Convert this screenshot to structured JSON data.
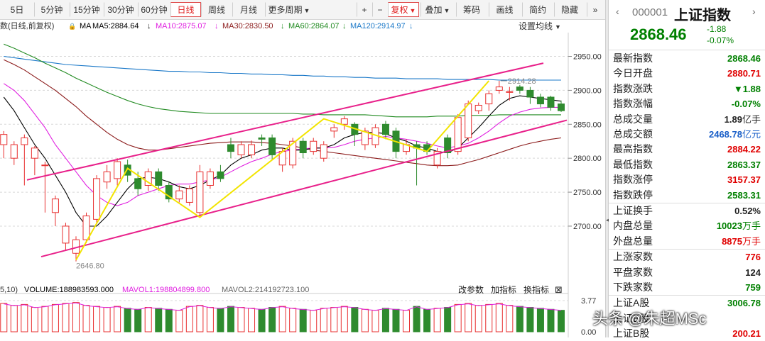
{
  "toolbar": {
    "periods": [
      "5日",
      "5分钟",
      "15分钟",
      "30分钟",
      "60分钟",
      "日线",
      "周线",
      "月线",
      "更多周期"
    ],
    "selected_period": "日线",
    "right_buttons": [
      "+",
      "−",
      "复权",
      "叠加",
      "筹码",
      "画线",
      "简约",
      "隐藏",
      "»"
    ],
    "selected_right": "复权"
  },
  "info": {
    "prefix": "数(日线,前复权)",
    "ma_label": "MA",
    "ma5": "MA5:2884.64",
    "ma10": "MA10:2875.07",
    "ma30": "MA30:2830.50",
    "ma60": "MA60:2864.07",
    "ma120": "MA120:2914.97",
    "set_ma": "设置均线",
    "arrow": "↓"
  },
  "colors": {
    "up": "#e83030",
    "down": "#2e8b2e",
    "ma5": "#000000",
    "ma10": "#e020e0",
    "ma30": "#8b1a1a",
    "ma60": "#228b22",
    "ma120": "#1a78c8",
    "channel": "#e8208a",
    "wave": "#f2e400"
  },
  "chart_data": {
    "type": "candlestick",
    "price_ticks": [
      "2950.00",
      "2900.00",
      "2850.00",
      "2800.00",
      "2750.00",
      "2700.00"
    ],
    "price_tick_values": [
      2950,
      2900,
      2850,
      2800,
      2750,
      2700
    ],
    "ylim": [
      2630,
      2985
    ],
    "high_label": "2914.28",
    "low_label": "2646.80",
    "candles": [
      [
        2820,
        2835,
        2800,
        2840
      ],
      [
        2800,
        2820,
        2790,
        2825
      ],
      [
        2820,
        2830,
        2760,
        2835
      ],
      [
        2800,
        2815,
        2775,
        2818
      ],
      [
        2790,
        2790,
        2720,
        2795
      ],
      [
        2720,
        2740,
        2700,
        2745
      ],
      [
        2675,
        2700,
        2665,
        2705
      ],
      [
        2660,
        2680,
        2648,
        2685
      ],
      [
        2680,
        2715,
        2675,
        2720
      ],
      [
        2710,
        2770,
        2705,
        2775
      ],
      [
        2765,
        2780,
        2755,
        2790
      ],
      [
        2770,
        2795,
        2760,
        2800
      ],
      [
        2790,
        2775,
        2765,
        2798
      ],
      [
        2770,
        2755,
        2745,
        2780
      ],
      [
        2760,
        2780,
        2752,
        2785
      ],
      [
        2780,
        2760,
        2752,
        2785
      ],
      [
        2760,
        2740,
        2735,
        2765
      ],
      [
        2740,
        2752,
        2735,
        2760
      ],
      [
        2735,
        2755,
        2730,
        2760
      ],
      [
        2720,
        2780,
        2715,
        2790
      ],
      [
        2760,
        2780,
        2755,
        2785
      ],
      [
        2780,
        2770,
        2765,
        2790
      ],
      [
        2820,
        2810,
        2800,
        2830
      ],
      [
        2805,
        2820,
        2800,
        2825
      ],
      [
        2805,
        2820,
        2800,
        2826
      ],
      [
        2830,
        2828,
        2818,
        2835
      ],
      [
        2830,
        2805,
        2798,
        2835
      ],
      [
        2790,
        2810,
        2780,
        2815
      ],
      [
        2790,
        2825,
        2785,
        2830
      ],
      [
        2825,
        2808,
        2800,
        2830
      ],
      [
        2810,
        2825,
        2805,
        2830
      ],
      [
        2800,
        2820,
        2795,
        2825
      ],
      [
        2840,
        2845,
        2830,
        2850
      ],
      [
        2850,
        2858,
        2842,
        2862
      ],
      [
        2850,
        2835,
        2818,
        2853
      ],
      [
        2820,
        2840,
        2812,
        2845
      ],
      [
        2820,
        2845,
        2815,
        2850
      ],
      [
        2850,
        2835,
        2828,
        2855
      ],
      [
        2840,
        2810,
        2800,
        2845
      ],
      [
        2810,
        2820,
        2805,
        2828
      ],
      [
        2820,
        2815,
        2760,
        2825
      ],
      [
        2820,
        2810,
        2805,
        2825
      ],
      [
        2790,
        2810,
        2785,
        2815
      ],
      [
        2830,
        2808,
        2800,
        2835
      ],
      [
        2810,
        2860,
        2805,
        2865
      ],
      [
        2830,
        2880,
        2825,
        2885
      ],
      [
        2870,
        2878,
        2865,
        2882
      ],
      [
        2880,
        2895,
        2870,
        2900
      ],
      [
        2900,
        2905,
        2895,
        2914
      ],
      [
        2897,
        2898,
        2885,
        2905
      ],
      [
        2905,
        2900,
        2895,
        2908
      ],
      [
        2900,
        2890,
        2880,
        2905
      ],
      [
        2890,
        2880,
        2875,
        2895
      ],
      [
        2890,
        2875,
        2870,
        2892
      ],
      [
        2880,
        2870,
        2868,
        2885
      ]
    ],
    "ma_series": {
      "ma5": [
        2890,
        2870,
        2845,
        2820,
        2800,
        2775,
        2750,
        2720,
        2700,
        2700,
        2715,
        2735,
        2755,
        2770,
        2772,
        2770,
        2765,
        2758,
        2755,
        2760,
        2768,
        2775,
        2790,
        2800,
        2805,
        2812,
        2815,
        2815,
        2812,
        2812,
        2815,
        2815,
        2820,
        2830,
        2835,
        2838,
        2838,
        2836,
        2830,
        2825,
        2818,
        2815,
        2810,
        2808,
        2815,
        2830,
        2845,
        2862,
        2878,
        2888,
        2892,
        2890,
        2888,
        2886,
        2884
      ],
      "ma10": [
        2910,
        2900,
        2885,
        2865,
        2845,
        2820,
        2800,
        2780,
        2760,
        2745,
        2735,
        2730,
        2735,
        2745,
        2750,
        2755,
        2760,
        2762,
        2762,
        2765,
        2768,
        2772,
        2780,
        2788,
        2795,
        2800,
        2806,
        2810,
        2812,
        2814,
        2815,
        2815,
        2816,
        2820,
        2825,
        2828,
        2830,
        2832,
        2830,
        2828,
        2825,
        2822,
        2818,
        2815,
        2818,
        2822,
        2830,
        2840,
        2852,
        2862,
        2868,
        2872,
        2874,
        2875,
        2875
      ],
      "ma30": [
        2945,
        2938,
        2930,
        2920,
        2910,
        2900,
        2888,
        2876,
        2862,
        2850,
        2838,
        2828,
        2820,
        2815,
        2812,
        2812,
        2814,
        2816,
        2818,
        2820,
        2822,
        2823,
        2824,
        2824,
        2824,
        2823,
        2822,
        2820,
        2818,
        2815,
        2812,
        2810,
        2808,
        2806,
        2804,
        2802,
        2800,
        2798,
        2796,
        2794,
        2792,
        2790,
        2789,
        2789,
        2790,
        2794,
        2798,
        2803,
        2808,
        2813,
        2818,
        2822,
        2825,
        2828,
        2830
      ],
      "ma60": [
        2968,
        2962,
        2955,
        2948,
        2940,
        2933,
        2926,
        2918,
        2911,
        2904,
        2897,
        2891,
        2885,
        2880,
        2876,
        2873,
        2871,
        2869,
        2868,
        2867,
        2866,
        2866,
        2866,
        2866,
        2866,
        2866,
        2866,
        2866,
        2866,
        2865,
        2865,
        2864,
        2864,
        2864,
        2864,
        2864,
        2863,
        2862,
        2861,
        2861,
        2861,
        2861,
        2862,
        2862,
        2862,
        2863,
        2863,
        2863,
        2864,
        2864,
        2864,
        2864,
        2864,
        2864,
        2864
      ],
      "ma120": [
        2950,
        2948,
        2946,
        2944,
        2942,
        2940,
        2938,
        2937,
        2936,
        2935,
        2934,
        2933,
        2932,
        2931,
        2930,
        2929,
        2928,
        2928,
        2927,
        2927,
        2926,
        2926,
        2925,
        2925,
        2924,
        2924,
        2923,
        2923,
        2922,
        2922,
        2921,
        2921,
        2920,
        2920,
        2919,
        2919,
        2918,
        2918,
        2918,
        2917,
        2917,
        2917,
        2917,
        2916,
        2916,
        2916,
        2916,
        2916,
        2915,
        2915,
        2915,
        2915,
        2915,
        2915,
        2915
      ]
    },
    "volume": {
      "label": "VOLUME:188983593.000",
      "prefix": "5,10)",
      "mavol1": "MAVOL1:198804899.800",
      "mavol2": "MAVOL2:214192723.100",
      "ticks": [
        "3.77",
        "0.00"
      ],
      "ylim": [
        0,
        3.77
      ],
      "values": [
        2.9,
        2.7,
        2.8,
        2.5,
        2.6,
        2.8,
        2.9,
        3.0,
        2.7,
        2.6,
        2.5,
        2.6,
        2.4,
        2.3,
        2.5,
        2.4,
        2.3,
        2.2,
        2.6,
        2.7,
        2.5,
        2.4,
        2.6,
        2.5,
        2.4,
        2.3,
        2.5,
        2.6,
        2.4,
        2.3,
        2.2,
        2.4,
        2.5,
        2.6,
        2.5,
        2.3,
        2.2,
        2.4,
        2.3,
        2.2,
        2.6,
        2.3,
        2.4,
        2.5,
        2.8,
        2.9,
        2.7,
        2.8,
        2.9,
        2.7,
        2.6,
        2.5,
        2.4,
        2.3,
        2.2
      ]
    }
  },
  "vol_buttons": [
    "改参数",
    "加指标",
    "换指标",
    "⊠"
  ],
  "panel": {
    "nav_prev": "‹",
    "nav_next": "›",
    "code": "000001",
    "name": "上证指数",
    "price": "2868.46",
    "change": "-1.88",
    "change_pct": "-0.07%",
    "rows": [
      {
        "label": "最新指数",
        "value": "2868.46",
        "color": "#008000",
        "unit": ""
      },
      {
        "label": "今日开盘",
        "value": "2880.71",
        "color": "#e00000",
        "unit": ""
      },
      {
        "label": "指数涨跌",
        "value": "▼1.88",
        "color": "#008000",
        "unit": ""
      },
      {
        "label": "指数涨幅",
        "value": "-0.07%",
        "color": "#008000",
        "unit": ""
      },
      {
        "label": "总成交量",
        "value": "1.89",
        "color": "#222",
        "unit": "亿手"
      },
      {
        "label": "总成交额",
        "value": "2468.78",
        "color": "#1a5fc8",
        "unit": "亿元"
      },
      {
        "label": "最高指数",
        "value": "2884.22",
        "color": "#e00000",
        "unit": ""
      },
      {
        "label": "最低指数",
        "value": "2863.37",
        "color": "#008000",
        "unit": ""
      },
      {
        "label": "指数涨停",
        "value": "3157.37",
        "color": "#e00000",
        "unit": ""
      },
      {
        "label": "指数跌停",
        "value": "2583.31",
        "color": "#008000",
        "unit": ""
      },
      {
        "label": "上证换手",
        "value": "0.52%",
        "color": "#222",
        "unit": ""
      },
      {
        "label": "内盘总量",
        "value": "10023",
        "color": "#008000",
        "unit": "万手"
      },
      {
        "label": "外盘总量",
        "value": "8875",
        "color": "#e00000",
        "unit": "万手"
      },
      {
        "label": "上涨家数",
        "value": "776",
        "color": "#e00000",
        "unit": ""
      },
      {
        "label": "平盘家数",
        "value": "124",
        "color": "#222",
        "unit": ""
      },
      {
        "label": "下跌家数",
        "value": "759",
        "color": "#008000",
        "unit": ""
      },
      {
        "label": "上证A股",
        "value": "3006.78",
        "color": "#008000",
        "unit": ""
      },
      {
        "label": "上证B股",
        "value": "",
        "color": "#222",
        "unit": ""
      },
      {
        "label": "上证B股",
        "value": "200.21",
        "color": "#e00000",
        "unit": ""
      }
    ]
  },
  "watermark": "头条 @朱超MSc"
}
